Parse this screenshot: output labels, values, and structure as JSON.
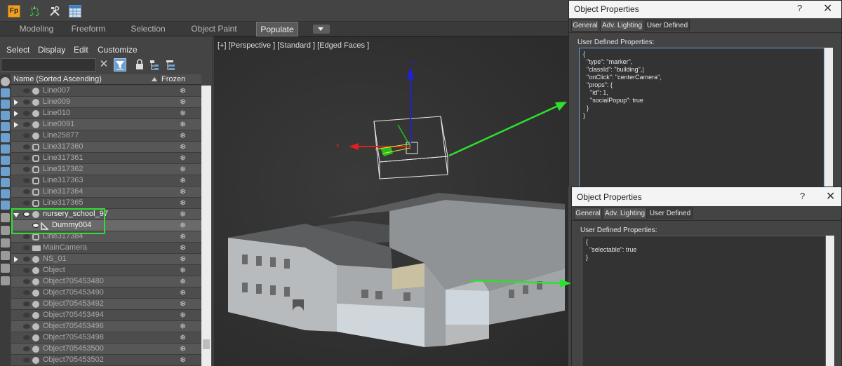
{
  "toolbar": {
    "icons": [
      "fp-plugin-icon",
      "tree-icon",
      "tools-icon",
      "table-icon"
    ],
    "fp_label": "Fp"
  },
  "ribbon": {
    "tabs": [
      {
        "label": "Modeling",
        "active": false
      },
      {
        "label": "Freeform",
        "active": false
      },
      {
        "label": "Selection",
        "active": false
      },
      {
        "label": "Object Paint",
        "active": false
      },
      {
        "label": "Populate",
        "active": true
      }
    ]
  },
  "explorer": {
    "menu": [
      "Select",
      "Display",
      "Edit",
      "Customize"
    ],
    "search_value": "",
    "clear_glyph": "✕",
    "columns": {
      "name": "Name (Sorted Ascending)",
      "frozen": "Frozen"
    },
    "frozen_glyph": "❄",
    "rows": [
      {
        "label": "Line007",
        "expand": "none",
        "eye": false,
        "kind": "dot"
      },
      {
        "label": "Line009",
        "expand": "closed",
        "eye": false,
        "kind": "dot"
      },
      {
        "label": "Line010",
        "expand": "closed",
        "eye": false,
        "kind": "dot"
      },
      {
        "label": "Line0091",
        "expand": "closed",
        "eye": false,
        "kind": "dot"
      },
      {
        "label": "Line25877",
        "expand": "none",
        "eye": false,
        "kind": "dot"
      },
      {
        "label": "Line317360",
        "expand": "none",
        "eye": false,
        "kind": "shape"
      },
      {
        "label": "Line317361",
        "expand": "none",
        "eye": false,
        "kind": "shape"
      },
      {
        "label": "Line317362",
        "expand": "none",
        "eye": false,
        "kind": "shape"
      },
      {
        "label": "Line317363",
        "expand": "none",
        "eye": false,
        "kind": "shape"
      },
      {
        "label": "Line317364",
        "expand": "none",
        "eye": false,
        "kind": "shape"
      },
      {
        "label": "Line317365",
        "expand": "none",
        "eye": false,
        "kind": "shape"
      },
      {
        "label": "nursery_school_97",
        "expand": "open",
        "eye": true,
        "kind": "dot",
        "bright": true
      },
      {
        "label": "Dummy004",
        "expand": "none",
        "eye": true,
        "kind": "dummy",
        "bright": true,
        "selected": true,
        "indent": true
      },
      {
        "label": "Line317384",
        "expand": "none",
        "eye": false,
        "kind": "shape"
      },
      {
        "label": "MainCamera",
        "expand": "none",
        "eye": false,
        "kind": "cam"
      },
      {
        "label": "NS_01",
        "expand": "closed",
        "eye": false,
        "kind": "dot"
      },
      {
        "label": "Object",
        "expand": "none",
        "eye": false,
        "kind": "dot"
      },
      {
        "label": "Object705453480",
        "expand": "none",
        "eye": false,
        "kind": "dot"
      },
      {
        "label": "Object705453490",
        "expand": "none",
        "eye": false,
        "kind": "dot"
      },
      {
        "label": "Object705453492",
        "expand": "none",
        "eye": false,
        "kind": "dot"
      },
      {
        "label": "Object705453494",
        "expand": "none",
        "eye": false,
        "kind": "dot"
      },
      {
        "label": "Object705453496",
        "expand": "none",
        "eye": false,
        "kind": "dot"
      },
      {
        "label": "Object705453498",
        "expand": "none",
        "eye": false,
        "kind": "dot"
      },
      {
        "label": "Object705453500",
        "expand": "none",
        "eye": false,
        "kind": "dot"
      },
      {
        "label": "Object705453502",
        "expand": "none",
        "eye": false,
        "kind": "dot"
      }
    ]
  },
  "viewport": {
    "label": "[+] [Perspective ] [Standard ] [Edged Faces ]",
    "gizmo": {
      "x_label": "x",
      "z_label": "z"
    }
  },
  "dialog_top": {
    "title": "Object Properties",
    "help": "?",
    "close": "✕",
    "tabs": [
      {
        "label": "General",
        "active": false
      },
      {
        "label": "Adv. Lighting",
        "active": false
      },
      {
        "label": "User Defined",
        "active": true
      }
    ],
    "udp_label": "User Defined Properties:",
    "udp_text": "{\n  \"type\": \"marker\",\n  \"classId\": \"building\",|\n  \"onClick\": \"centerCamera\",\n  \"props\": {\n    \"id\": 1,\n    \"socialPopup\": true\n  }\n}"
  },
  "dialog_bottom": {
    "title": "Object Properties",
    "help": "?",
    "close": "✕",
    "tabs": [
      {
        "label": "General",
        "active": false
      },
      {
        "label": "Adv. Lighting",
        "active": false
      },
      {
        "label": "User Defined",
        "active": true
      }
    ],
    "udp_label": "User Defined Properties:",
    "udp_text": "{\n  \"selectable\": true\n}"
  },
  "colors": {
    "highlight": "#2de02d",
    "gizmo_x": "#e02020",
    "gizmo_y": "#20c020",
    "gizmo_z": "#2020e0",
    "selection_blue": "#6ea0cf"
  }
}
